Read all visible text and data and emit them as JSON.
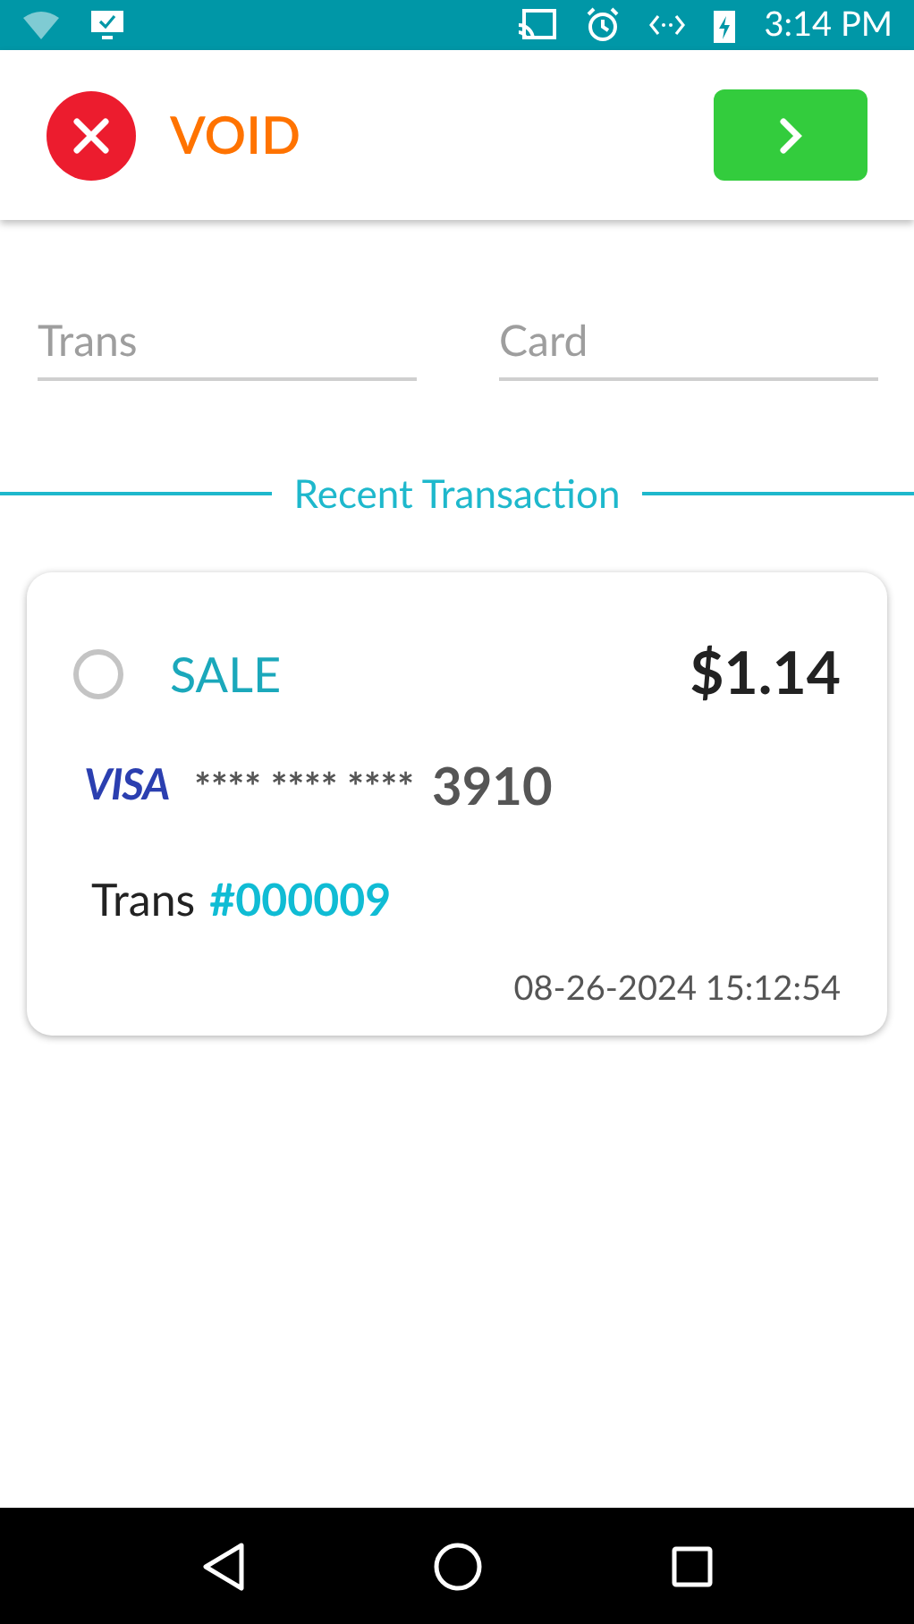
{
  "status_bar": {
    "time": "3:14 PM"
  },
  "header": {
    "title": "VOID"
  },
  "fields": [
    {
      "placeholder": "Trans"
    },
    {
      "placeholder": "Card"
    }
  ],
  "section_title": "Recent Transaction",
  "transactions": [
    {
      "selected": false,
      "type": "SALE",
      "amount": "$1.14",
      "brand": "VISA",
      "masked": "**** **** ****",
      "last4": "3910",
      "trans_label": "Trans",
      "trans_no": "#000009",
      "datetime": "08-26-2024 15:12:54"
    }
  ]
}
